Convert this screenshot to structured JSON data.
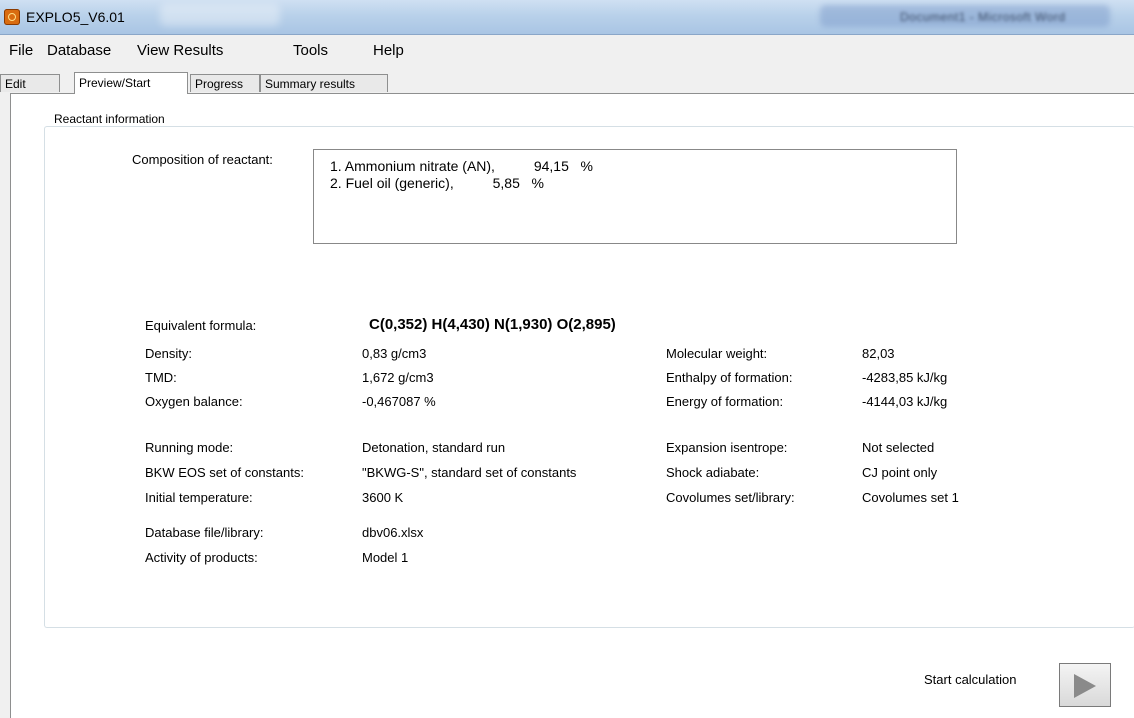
{
  "window": {
    "title": "EXPLO5_V6.01",
    "blurred_right_title": "Document1 - Microsoft Word"
  },
  "menu": [
    "File",
    "Database",
    "View Results",
    "Tools",
    "Help"
  ],
  "tabs": [
    "Edit",
    "Preview/Start",
    "Progress",
    "Summary results"
  ],
  "active_tab": "Preview/Start",
  "group_title": "Reactant information",
  "composition": {
    "label": "Composition of reactant:",
    "lines": [
      "1. Ammonium nitrate (AN),          94,15   %",
      "2. Fuel oil (generic),          5,85   %"
    ]
  },
  "left_fields": [
    {
      "label": "Equivalent formula:",
      "value": "C(0,352) H(4,430) N(1,930) O(2,895)"
    },
    {
      "label": "Density:",
      "value": "0,83  g/cm3"
    },
    {
      "label": "TMD:",
      "value": "1,672  g/cm3"
    },
    {
      "label": "Oxygen balance:",
      "value": "-0,467087  %"
    },
    {
      "label": "Running mode:",
      "value": "Detonation, standard run"
    },
    {
      "label": "BKW EOS set of constants:",
      "value": "\"BKWG-S\", standard set of constants"
    },
    {
      "label": "Initial temperature:",
      "value": "3600  K"
    },
    {
      "label": "Database file/library:",
      "value": "dbv06.xlsx"
    },
    {
      "label": "Activity of products:",
      "value": "Model 1"
    }
  ],
  "right_fields": [
    {
      "label": "Molecular weight:",
      "value": "82,03"
    },
    {
      "label": "Enthalpy of formation:",
      "value": "-4283,85  kJ/kg"
    },
    {
      "label": "Energy of formation:",
      "value": "-4144,03  kJ/kg"
    },
    {
      "label": "Expansion isentrope:",
      "value": "Not selected"
    },
    {
      "label": "Shock adiabate:",
      "value": "CJ point only"
    },
    {
      "label": "Covolumes set/library:",
      "value": "Covolumes set 1"
    }
  ],
  "start": {
    "label": "Start calculation",
    "icon": "play-icon"
  }
}
